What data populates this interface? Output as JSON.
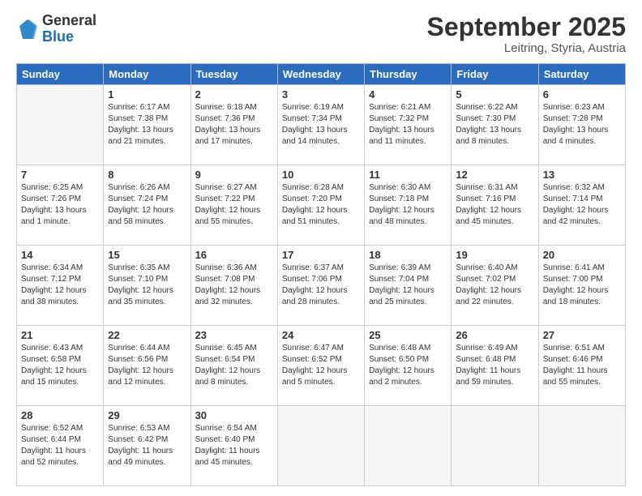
{
  "logo": {
    "general": "General",
    "blue": "Blue"
  },
  "header": {
    "month": "September 2025",
    "location": "Leitring, Styria, Austria"
  },
  "weekdays": [
    "Sunday",
    "Monday",
    "Tuesday",
    "Wednesday",
    "Thursday",
    "Friday",
    "Saturday"
  ],
  "weeks": [
    [
      {
        "day": "",
        "empty": true
      },
      {
        "day": "1",
        "sunrise": "6:17 AM",
        "sunset": "7:38 PM",
        "daylight": "13 hours and 21 minutes."
      },
      {
        "day": "2",
        "sunrise": "6:18 AM",
        "sunset": "7:36 PM",
        "daylight": "13 hours and 17 minutes."
      },
      {
        "day": "3",
        "sunrise": "6:19 AM",
        "sunset": "7:34 PM",
        "daylight": "13 hours and 14 minutes."
      },
      {
        "day": "4",
        "sunrise": "6:21 AM",
        "sunset": "7:32 PM",
        "daylight": "13 hours and 11 minutes."
      },
      {
        "day": "5",
        "sunrise": "6:22 AM",
        "sunset": "7:30 PM",
        "daylight": "13 hours and 8 minutes."
      },
      {
        "day": "6",
        "sunrise": "6:23 AM",
        "sunset": "7:28 PM",
        "daylight": "13 hours and 4 minutes."
      }
    ],
    [
      {
        "day": "7",
        "sunrise": "6:25 AM",
        "sunset": "7:26 PM",
        "daylight": "13 hours and 1 minute."
      },
      {
        "day": "8",
        "sunrise": "6:26 AM",
        "sunset": "7:24 PM",
        "daylight": "12 hours and 58 minutes."
      },
      {
        "day": "9",
        "sunrise": "6:27 AM",
        "sunset": "7:22 PM",
        "daylight": "12 hours and 55 minutes."
      },
      {
        "day": "10",
        "sunrise": "6:28 AM",
        "sunset": "7:20 PM",
        "daylight": "12 hours and 51 minutes."
      },
      {
        "day": "11",
        "sunrise": "6:30 AM",
        "sunset": "7:18 PM",
        "daylight": "12 hours and 48 minutes."
      },
      {
        "day": "12",
        "sunrise": "6:31 AM",
        "sunset": "7:16 PM",
        "daylight": "12 hours and 45 minutes."
      },
      {
        "day": "13",
        "sunrise": "6:32 AM",
        "sunset": "7:14 PM",
        "daylight": "12 hours and 42 minutes."
      }
    ],
    [
      {
        "day": "14",
        "sunrise": "6:34 AM",
        "sunset": "7:12 PM",
        "daylight": "12 hours and 38 minutes."
      },
      {
        "day": "15",
        "sunrise": "6:35 AM",
        "sunset": "7:10 PM",
        "daylight": "12 hours and 35 minutes."
      },
      {
        "day": "16",
        "sunrise": "6:36 AM",
        "sunset": "7:08 PM",
        "daylight": "12 hours and 32 minutes."
      },
      {
        "day": "17",
        "sunrise": "6:37 AM",
        "sunset": "7:06 PM",
        "daylight": "12 hours and 28 minutes."
      },
      {
        "day": "18",
        "sunrise": "6:39 AM",
        "sunset": "7:04 PM",
        "daylight": "12 hours and 25 minutes."
      },
      {
        "day": "19",
        "sunrise": "6:40 AM",
        "sunset": "7:02 PM",
        "daylight": "12 hours and 22 minutes."
      },
      {
        "day": "20",
        "sunrise": "6:41 AM",
        "sunset": "7:00 PM",
        "daylight": "12 hours and 18 minutes."
      }
    ],
    [
      {
        "day": "21",
        "sunrise": "6:43 AM",
        "sunset": "6:58 PM",
        "daylight": "12 hours and 15 minutes."
      },
      {
        "day": "22",
        "sunrise": "6:44 AM",
        "sunset": "6:56 PM",
        "daylight": "12 hours and 12 minutes."
      },
      {
        "day": "23",
        "sunrise": "6:45 AM",
        "sunset": "6:54 PM",
        "daylight": "12 hours and 8 minutes."
      },
      {
        "day": "24",
        "sunrise": "6:47 AM",
        "sunset": "6:52 PM",
        "daylight": "12 hours and 5 minutes."
      },
      {
        "day": "25",
        "sunrise": "6:48 AM",
        "sunset": "6:50 PM",
        "daylight": "12 hours and 2 minutes."
      },
      {
        "day": "26",
        "sunrise": "6:49 AM",
        "sunset": "6:48 PM",
        "daylight": "11 hours and 59 minutes."
      },
      {
        "day": "27",
        "sunrise": "6:51 AM",
        "sunset": "6:46 PM",
        "daylight": "11 hours and 55 minutes."
      }
    ],
    [
      {
        "day": "28",
        "sunrise": "6:52 AM",
        "sunset": "6:44 PM",
        "daylight": "11 hours and 52 minutes."
      },
      {
        "day": "29",
        "sunrise": "6:53 AM",
        "sunset": "6:42 PM",
        "daylight": "11 hours and 49 minutes."
      },
      {
        "day": "30",
        "sunrise": "6:54 AM",
        "sunset": "6:40 PM",
        "daylight": "11 hours and 45 minutes."
      },
      {
        "day": "",
        "empty": true
      },
      {
        "day": "",
        "empty": true
      },
      {
        "day": "",
        "empty": true
      },
      {
        "day": "",
        "empty": true
      }
    ]
  ]
}
